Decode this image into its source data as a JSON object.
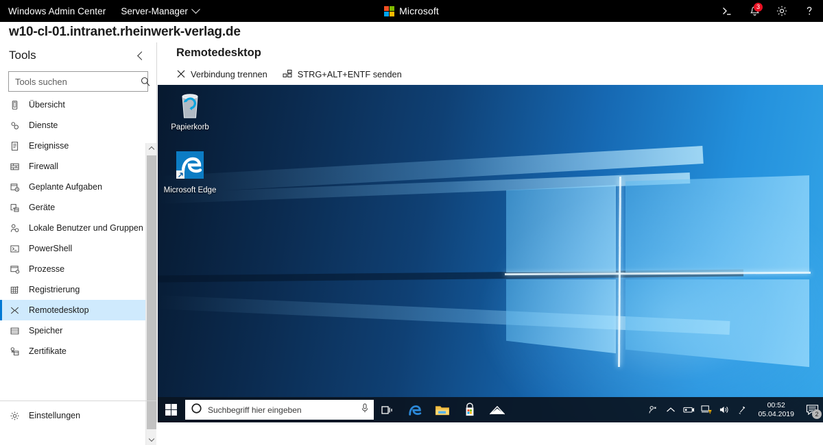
{
  "topbar": {
    "brand": "Windows Admin Center",
    "module": "Server-Manager",
    "module_chevron_icon": "chevron-down-icon",
    "center_brand": "Microsoft",
    "icons": [
      {
        "name": "powershell-icon",
        "label": ">_"
      },
      {
        "name": "notifications-bell-icon",
        "badge": "3"
      },
      {
        "name": "settings-gear-icon"
      },
      {
        "name": "help-question-icon"
      }
    ]
  },
  "host": {
    "title": "w10-cl-01.intranet.rheinwerk-verlag.de"
  },
  "sidebar": {
    "title": "Tools",
    "collapse_icon": "chevron-left-icon",
    "search": {
      "placeholder": "Tools suchen",
      "value": "",
      "icon": "search-icon"
    },
    "items": [
      {
        "label": "Übersicht",
        "icon": "overview-icon"
      },
      {
        "label": "Dienste",
        "icon": "services-gears-icon"
      },
      {
        "label": "Ereignisse",
        "icon": "events-list-icon"
      },
      {
        "label": "Firewall",
        "icon": "firewall-bricks-icon"
      },
      {
        "label": "Geplante Aufgaben",
        "icon": "scheduled-tasks-clock-icon"
      },
      {
        "label": "Geräte",
        "icon": "devices-icon"
      },
      {
        "label": "Lokale Benutzer und Gruppen",
        "icon": "local-users-groups-icon"
      },
      {
        "label": "PowerShell",
        "icon": "powershell-console-icon"
      },
      {
        "label": "Prozesse",
        "icon": "processes-icon"
      },
      {
        "label": "Registrierung",
        "icon": "registry-grid-icon"
      },
      {
        "label": "Remotedesktop",
        "icon": "remote-desktop-icon",
        "selected": true
      },
      {
        "label": "Speicher",
        "icon": "storage-disks-icon"
      },
      {
        "label": "Zertifikate",
        "icon": "certificates-icon"
      }
    ],
    "settings": {
      "label": "Einstellungen",
      "icon": "settings-gear-icon"
    },
    "scrollbar": {
      "up_icon": "scroll-up-arrow-icon",
      "down_icon": "scroll-down-arrow-icon"
    }
  },
  "main": {
    "title": "Remotedesktop",
    "commands": [
      {
        "label": "Verbindung trennen",
        "icon": "disconnect-x-icon"
      },
      {
        "label": "STRG+ALT+ENTF senden",
        "icon": "keyboard-keys-icon"
      }
    ]
  },
  "remote_desktop": {
    "desktop_icons": [
      {
        "label": "Papierkorb",
        "icon": "recycle-bin-icon"
      },
      {
        "label": "Microsoft Edge",
        "icon": "microsoft-edge-icon"
      }
    ],
    "taskbar": {
      "start_icon": "windows-start-icon",
      "search": {
        "placeholder": "Suchbegriff hier eingeben",
        "value": "",
        "icon": "cortana-circle-icon",
        "mic_icon": "microphone-icon"
      },
      "apps": [
        {
          "name": "task-view-icon"
        },
        {
          "name": "microsoft-edge-icon"
        },
        {
          "name": "file-explorer-icon"
        },
        {
          "name": "microsoft-store-icon"
        },
        {
          "name": "mail-icon"
        }
      ],
      "tray": [
        {
          "name": "people-icon"
        },
        {
          "name": "show-hidden-icons-chevron-icon"
        },
        {
          "name": "removable-media-icon"
        },
        {
          "name": "network-warning-icon"
        },
        {
          "name": "volume-speaker-icon"
        },
        {
          "name": "bluetooth-pen-icon"
        }
      ],
      "clock": {
        "time": "00:52",
        "date": "05.04.2019"
      },
      "action_center": {
        "icon": "action-center-icon",
        "badge": "2"
      }
    }
  },
  "colors": {
    "accent": "#0078d4",
    "selection": "#cfeafd",
    "topbar_bg": "#000000",
    "badge_red": "#e81123",
    "edge_blue": "#0078d7"
  }
}
